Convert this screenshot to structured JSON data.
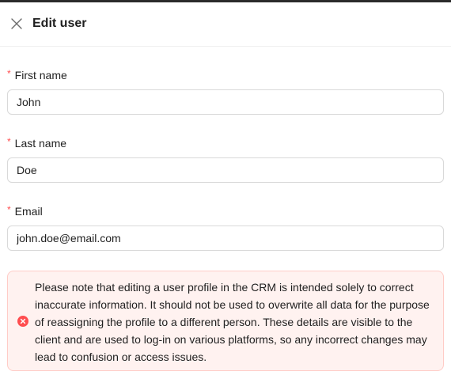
{
  "drawer": {
    "title": "Edit user",
    "close_icon": "close-icon"
  },
  "form": {
    "required_mark": "*",
    "first_name": {
      "label": "First name",
      "value": "John"
    },
    "last_name": {
      "label": "Last name",
      "value": "Doe"
    },
    "email": {
      "label": "Email",
      "value": "john.doe@email.com"
    }
  },
  "alert": {
    "type": "error",
    "icon": "close-circle-icon",
    "text": "Please note that editing a user profile in the CRM is intended solely to correct inaccurate information. It should not be used to overwrite all data for the purpose of reassigning the profile to a different person. These details are visible to the client and are used to log-in on various platforms, so any incorrect changes may lead to confusion or access issues."
  },
  "colors": {
    "required": "#ff4d4f",
    "error_bg": "#fff2f0",
    "error_border": "#ffccc7",
    "error_icon": "#ff4d4f"
  }
}
